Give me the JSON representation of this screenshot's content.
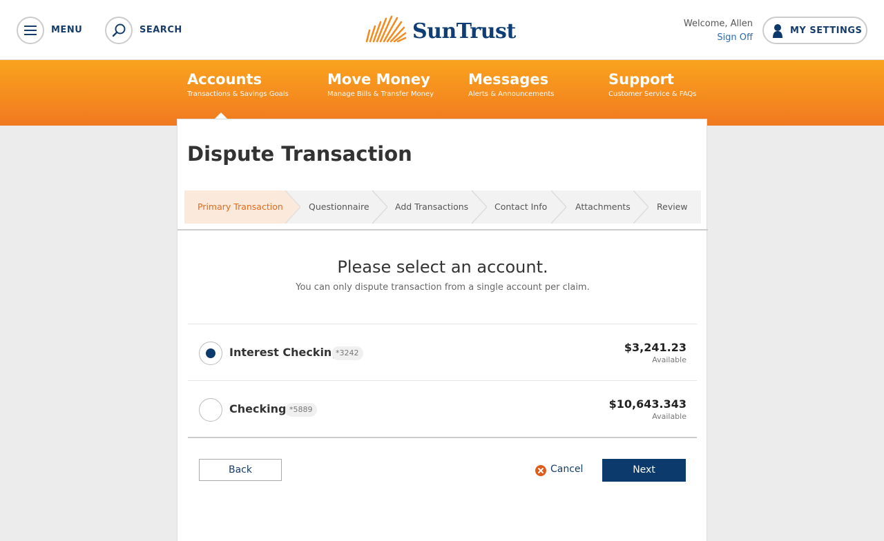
{
  "header": {
    "menu_label": "MENU",
    "search_label": "SEARCH",
    "brand": "SunTrust",
    "welcome": "Welcome, Allen",
    "sign_off": "Sign Off",
    "settings_label": "MY SETTINGS"
  },
  "nav": [
    {
      "title": "Accounts",
      "sub": "Transactions & Savings Goals"
    },
    {
      "title": "Move Money",
      "sub": "Manage Bills & Transfer Money"
    },
    {
      "title": "Messages",
      "sub": "Alerts & Announcements"
    },
    {
      "title": "Support",
      "sub": "Customer Service & FAQs"
    }
  ],
  "page": {
    "title": "Dispute Transaction",
    "steps": [
      {
        "label": "Primary Transaction",
        "active": true
      },
      {
        "label": "Questionnaire",
        "active": false
      },
      {
        "label": "Add Transactions",
        "active": false
      },
      {
        "label": "Contact Info",
        "active": false
      },
      {
        "label": "Attachments",
        "active": false
      },
      {
        "label": "Review",
        "active": false
      }
    ],
    "select_title": "Please select an account.",
    "select_sub": "You can only dispute transaction from a single account per claim.",
    "accounts": [
      {
        "name": "Interest Checking",
        "mask": "*3242",
        "balance": "$3,241.23",
        "available": "Available",
        "selected": true
      },
      {
        "name": "Checking",
        "mask": "*5889",
        "balance": "$10,643.343",
        "available": "Available",
        "selected": false
      }
    ],
    "back_label": "Back",
    "cancel_label": "Cancel",
    "next_label": "Next"
  },
  "colors": {
    "brand_navy": "#0c3a6c",
    "brand_orange": "#f58a1f",
    "active_step_bg": "#fbe9dc",
    "active_step_text": "#e06b1e",
    "cancel_icon": "#e25b1a"
  }
}
